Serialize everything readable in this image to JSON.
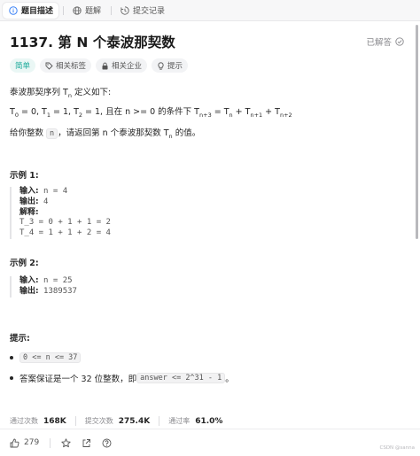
{
  "tabs": [
    {
      "label": "题目描述",
      "icon": "info-icon",
      "active": true
    },
    {
      "label": "题解",
      "icon": "globe-icon"
    },
    {
      "label": "提交记录",
      "icon": "history-icon"
    }
  ],
  "problem": {
    "title": "1137. 第 N 个泰波那契数",
    "solved_label": "已解答"
  },
  "tags": {
    "difficulty": "简单",
    "related_tags": "相关标签",
    "related_companies": "相关企业",
    "hint": "提示"
  },
  "description": {
    "line1_prefix": "泰波那契序列 T",
    "line1_sub": "n",
    "line1_suffix": " 定义如下: ",
    "def_T0": "T",
    "def_T0_sub": "0",
    "def_T0_tail": " = 0, T",
    "def_T1_sub": "1",
    "def_T1_tail": " = 1, T",
    "def_T2_sub": "2",
    "def_T2_tail": " = 1, 且在 n >= 0 的条件下 T",
    "def_n3_sub": "n+3",
    "def_eq": " = T",
    "def_n_sub": "n",
    "def_plus1": " + T",
    "def_n1_sub": "n+1",
    "def_plus2": " + T",
    "def_n2_sub": "n+2",
    "given_prefix": "给你整数 ",
    "given_code": "n",
    "given_mid": "，请返回第 n 个泰波那契数 T",
    "given_sub": "n",
    "given_suffix": " 的值。"
  },
  "example1": {
    "heading": "示例 1:",
    "input_label": "输入:",
    "input_value": " n = 4",
    "output_label": "输出:",
    "output_value": " 4",
    "explain_label": "解释:",
    "line1": "T_3 = 0 + 1 + 1 = 2",
    "line2": "T_4 = 1 + 1 + 2 = 4"
  },
  "example2": {
    "heading": "示例 2:",
    "input_label": "输入:",
    "input_value": " n = 25",
    "output_label": "输出:",
    "output_value": " 1389537"
  },
  "hints": {
    "heading": "提示:",
    "c1_code": "0 <= n <= 37",
    "c2_prefix": "答案保证是一个 32 位整数，即 ",
    "c2_code": "answer <= 2^31 - 1",
    "c2_suffix": "。"
  },
  "stats": {
    "passed_label": "通过次数",
    "passed_value": "168K",
    "submitted_label": "提交次数",
    "submitted_value": "275.4K",
    "rate_label": "通过率",
    "rate_value": "61.0%"
  },
  "bottom": {
    "likes": "279"
  },
  "watermark": "CSDN @sanna",
  "colors": {
    "easy": "#18a999",
    "text": "#262626",
    "muted": "#8a8a8e"
  }
}
